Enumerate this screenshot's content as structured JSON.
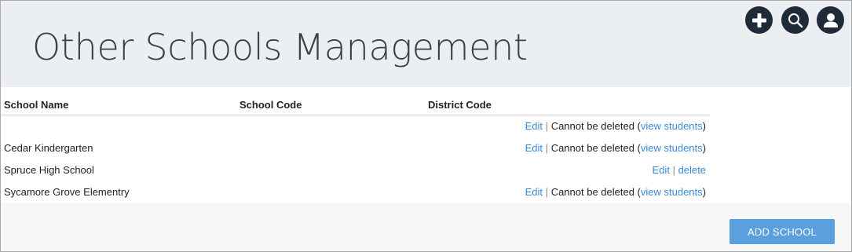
{
  "header": {
    "title": "Other Schools Management",
    "icons": [
      "add-icon",
      "search-icon",
      "user-icon"
    ]
  },
  "table": {
    "columns": [
      "School Name",
      "School Code",
      "District Code"
    ],
    "rows": [
      {
        "name": "",
        "edit": "Edit",
        "sep": "|",
        "note_prefix": "Cannot be deleted (",
        "view": "view students",
        "note_suffix": ")"
      },
      {
        "name": "Cedar Kindergarten",
        "edit": "Edit",
        "sep": "|",
        "note_prefix": "Cannot be deleted (",
        "view": "view students",
        "note_suffix": ")"
      },
      {
        "name": "Spruce High School",
        "edit": "Edit",
        "sep": "|",
        "delete": "delete"
      },
      {
        "name": "Sycamore Grove Elementry",
        "edit": "Edit",
        "sep": "|",
        "note_prefix": "Cannot be deleted (",
        "view": "view students",
        "note_suffix": ")"
      }
    ]
  },
  "footer": {
    "add_school_label": "ADD SCHOOL"
  },
  "colors": {
    "header_bg": "#eceff2",
    "icon_bg": "#1f2b38",
    "link": "#3b8ad6",
    "primary_button": "#5aa0df"
  }
}
